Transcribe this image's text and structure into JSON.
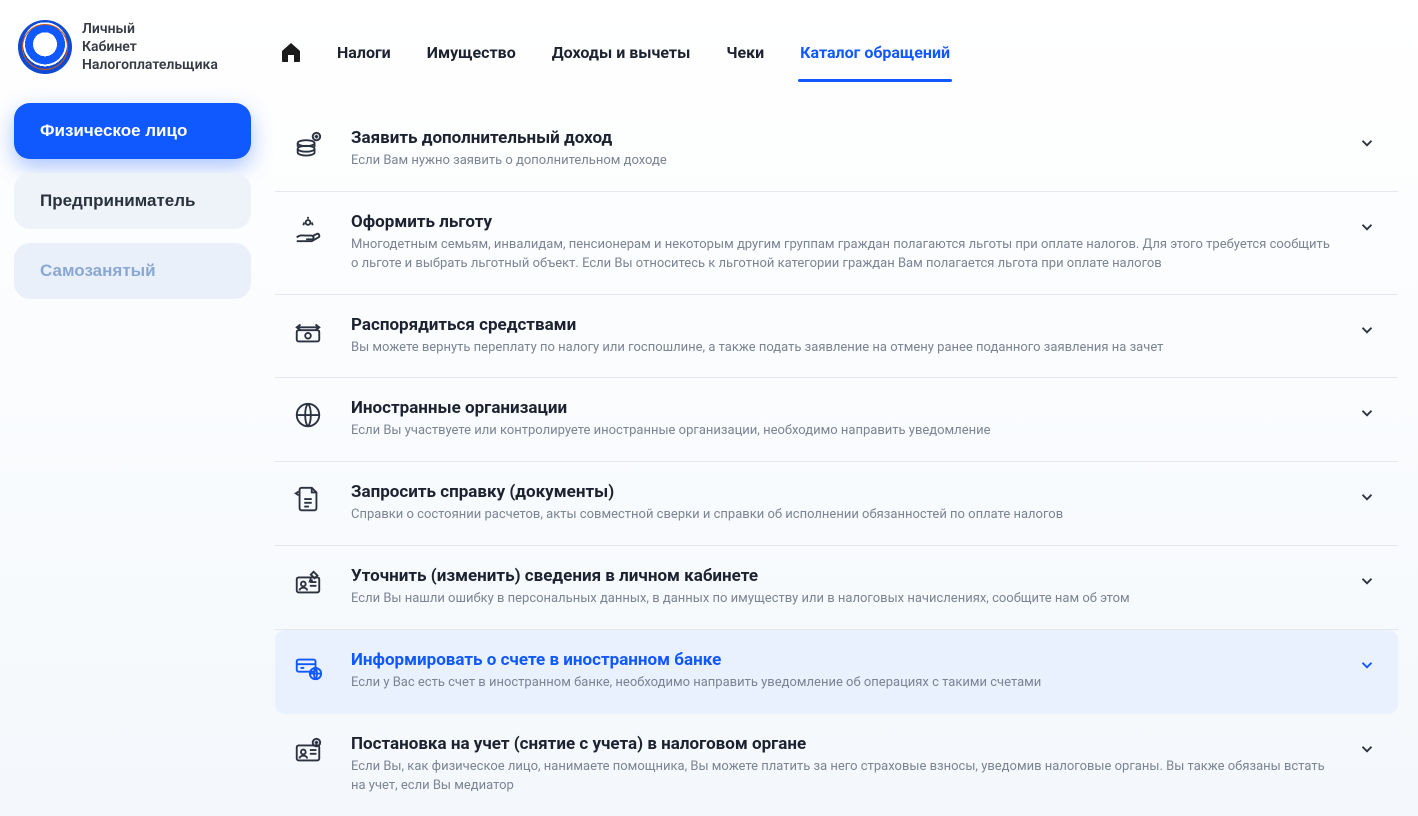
{
  "brand": {
    "line1": "Личный",
    "line2": "Кабинет",
    "line3": "Налогоплательщика"
  },
  "roles": [
    {
      "label": "Физическое лицо",
      "active": true
    },
    {
      "label": "Предприниматель",
      "active": false
    },
    {
      "label": "Самозанятый",
      "active": false
    }
  ],
  "nav": {
    "items": [
      "Налоги",
      "Имущество",
      "Доходы и вычеты",
      "Чеки",
      "Каталог обращений"
    ],
    "active_index": 4
  },
  "rows": [
    {
      "icon": "coins",
      "title": "Заявить дополнительный доход",
      "desc": "Если Вам нужно заявить о дополнительном доходе",
      "highlight": false
    },
    {
      "icon": "hand",
      "title": "Оформить льготу",
      "desc": "Многодетным семьям, инвалидам, пенсионерам и некоторым другим группам граждан полагаются льготы при оплате налогов. Для этого требуется сообщить о льготе и выбрать льготный объект. Если Вы относитесь к льготной категории граждан Вам полагается льгота при оплате налогов",
      "highlight": false
    },
    {
      "icon": "transfer",
      "title": "Распорядиться средствами",
      "desc": "Вы можете вернуть переплату по налогу или госпошлине, а также подать заявление на отмену ранее поданного заявления на зачет",
      "highlight": false
    },
    {
      "icon": "globe",
      "title": "Иностранные организации",
      "desc": "Если Вы участвуете или контролируете иностранные организации, необходимо направить уведомление",
      "highlight": false
    },
    {
      "icon": "doc",
      "title": "Запросить справку (документы)",
      "desc": "Справки о состоянии расчетов, акты совместной сверки и справки об исполнении обязанностей по оплате налогов",
      "highlight": false
    },
    {
      "icon": "idedit",
      "title": "Уточнить (изменить) сведения в личном кабинете",
      "desc": "Если Вы нашли ошибку в персональных данных, в данных по имуществу или в налоговых начислениях, сообщите нам об этом",
      "highlight": false
    },
    {
      "icon": "bankglobe",
      "title": "Информировать о счете в иностранном банке",
      "desc": "Если у Вас есть счет в иностранном банке, необходимо направить уведомление об операциях с такими счетами",
      "highlight": true
    },
    {
      "icon": "idplus",
      "title": "Постановка на учет (снятие с учета) в налоговом органе",
      "desc": "Если Вы, как физическое лицо, нанимаете помощника, Вы можете платить за него страховые взносы, уведомив налоговые органы. Вы также обязаны встать на учет, если Вы медиатор",
      "highlight": false
    }
  ]
}
